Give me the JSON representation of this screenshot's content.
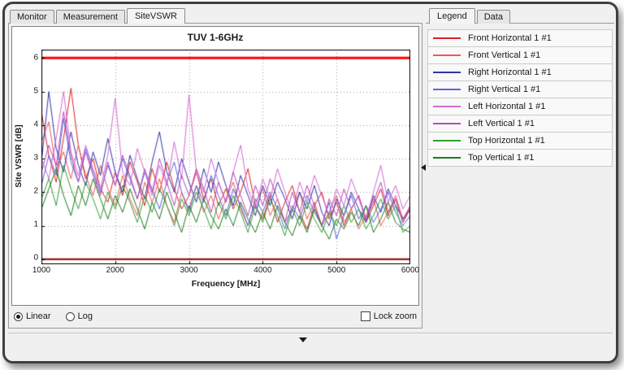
{
  "tabs": {
    "main": [
      {
        "label": "Monitor",
        "active": false
      },
      {
        "label": "Measurement",
        "active": false
      },
      {
        "label": "SiteVSWR",
        "active": true
      }
    ],
    "right": [
      {
        "label": "Legend",
        "active": true
      },
      {
        "label": "Data",
        "active": false
      }
    ]
  },
  "controls": {
    "linear_label": "Linear",
    "log_label": "Log",
    "scale_selected": "Linear",
    "lock_zoom_label": "Lock zoom",
    "lock_zoom_checked": false
  },
  "legend_panel": {
    "items": [
      {
        "label": "Front Horizontal 1 #1",
        "color": "#dd2222"
      },
      {
        "label": "Front Vertical 1 #1",
        "color": "#e85c5c"
      },
      {
        "label": "Right Horizontal 1 #1",
        "color": "#3333aa"
      },
      {
        "label": "Right Vertical 1 #1",
        "color": "#5566e0"
      },
      {
        "label": "Left Horizontal 1 #1",
        "color": "#d46ad4"
      },
      {
        "label": "Left Vertical 1 #1",
        "color": "#b84ab8"
      },
      {
        "label": "Top Horizontal 1 #1",
        "color": "#33a033"
      },
      {
        "label": "Top Vertical 1 #1",
        "color": "#1e7a1e"
      }
    ]
  },
  "chart_data": {
    "type": "line",
    "title": "TUV 1-6GHz",
    "xlabel": "Frequency [MHz]",
    "ylabel": "Site VSWR [dB]",
    "x_range": [
      1000,
      6000
    ],
    "y_range": [
      -0.15,
      6.25
    ],
    "x_ticks": [
      1000,
      2000,
      3000,
      4000,
      5000,
      6000
    ],
    "y_ticks": [
      0,
      1,
      2,
      3,
      4,
      5,
      6
    ],
    "x_start": 1000,
    "x_step": 100,
    "grid": "dotted",
    "legend_position": "right-panel",
    "limit_lines": [
      {
        "name": "upper-limit",
        "value": 6.0,
        "color": "#ff0000",
        "width": 3
      },
      {
        "name": "baseline",
        "value": 0.0,
        "color": "#8b0000",
        "width": 2
      }
    ],
    "series": [
      {
        "name": "Front Horizontal 1 #1",
        "color": "#dd2222",
        "values": [
          4.4,
          3.1,
          2.3,
          3.6,
          5.1,
          3.4,
          2.4,
          3.0,
          2.1,
          1.7,
          2.6,
          1.9,
          2.9,
          2.3,
          1.6,
          2.7,
          2.0,
          2.9,
          2.1,
          1.5,
          1.9,
          2.6,
          1.8,
          2.4,
          1.6,
          2.1,
          1.5,
          2.0,
          2.7,
          1.6,
          1.2,
          1.9,
          1.1,
          1.7,
          2.2,
          1.4,
          0.9,
          1.6,
          2.0,
          1.2,
          1.7,
          1.0,
          1.5,
          1.9,
          1.1,
          1.6,
          2.1,
          1.3,
          1.8,
          1.1,
          1.5
        ]
      },
      {
        "name": "Front Vertical 1 #1",
        "color": "#e85c5c",
        "values": [
          3.5,
          4.1,
          2.7,
          3.2,
          2.4,
          3.4,
          2.5,
          1.9,
          2.8,
          2.1,
          1.6,
          2.5,
          1.8,
          1.3,
          2.3,
          1.7,
          2.4,
          1.6,
          1.1,
          2.0,
          1.5,
          2.2,
          1.4,
          1.9,
          1.2,
          1.8,
          2.3,
          1.5,
          1.0,
          1.7,
          2.1,
          1.3,
          1.8,
          1.1,
          1.5,
          2.0,
          1.2,
          1.7,
          1.0,
          1.4,
          1.9,
          1.1,
          1.5,
          0.9,
          1.3,
          1.8,
          1.0,
          1.4,
          1.9,
          1.2,
          1.6
        ]
      },
      {
        "name": "Right Horizontal 1 #1",
        "color": "#3333aa",
        "values": [
          2.9,
          5.0,
          3.3,
          2.6,
          3.8,
          2.8,
          2.2,
          3.2,
          2.5,
          3.6,
          2.6,
          2.0,
          3.1,
          2.4,
          1.8,
          2.9,
          3.8,
          2.6,
          2.0,
          3.0,
          2.3,
          1.7,
          2.7,
          2.0,
          2.9,
          2.2,
          1.6,
          2.5,
          1.9,
          1.3,
          2.2,
          1.6,
          2.3,
          1.8,
          1.2,
          2.0,
          1.5,
          2.2,
          1.4,
          1.0,
          1.8,
          1.3,
          2.0,
          1.5,
          1.1,
          1.9,
          1.4,
          2.1,
          1.6,
          1.2,
          1.5
        ]
      },
      {
        "name": "Right Vertical 1 #1",
        "color": "#5566e0",
        "values": [
          2.2,
          3.1,
          2.5,
          4.2,
          2.9,
          2.3,
          3.3,
          2.6,
          2.0,
          2.8,
          2.2,
          3.0,
          2.4,
          1.8,
          2.6,
          2.1,
          1.5,
          2.3,
          2.9,
          2.0,
          1.4,
          2.2,
          1.7,
          2.5,
          1.9,
          1.3,
          2.1,
          1.6,
          1.0,
          1.8,
          1.4,
          2.0,
          1.5,
          0.9,
          1.6,
          1.2,
          1.9,
          1.4,
          1.0,
          1.7,
          0.6,
          1.3,
          1.9,
          1.2,
          1.6,
          1.1,
          1.5,
          2.0,
          1.4,
          1.0,
          1.3
        ]
      },
      {
        "name": "Left Horizontal 1 #1",
        "color": "#d46ad4",
        "values": [
          3.0,
          2.4,
          3.6,
          5.0,
          3.2,
          2.5,
          3.4,
          2.7,
          2.1,
          3.1,
          4.8,
          2.6,
          2.2,
          3.3,
          2.6,
          1.9,
          2.8,
          2.2,
          3.5,
          2.4,
          4.9,
          2.6,
          2.0,
          3.0,
          2.3,
          1.7,
          2.6,
          3.4,
          2.1,
          1.5,
          2.4,
          1.8,
          2.7,
          2.0,
          1.4,
          2.3,
          1.7,
          2.5,
          1.9,
          1.3,
          2.1,
          1.6,
          2.4,
          1.8,
          1.2,
          2.0,
          2.8,
          1.7,
          2.2,
          1.5,
          1.9
        ]
      },
      {
        "name": "Left Vertical 1 #1",
        "color": "#b84ab8",
        "values": [
          2.6,
          3.4,
          2.8,
          4.4,
          3.1,
          2.3,
          3.2,
          2.5,
          1.9,
          2.9,
          2.2,
          3.1,
          2.5,
          1.8,
          2.7,
          2.0,
          3.0,
          2.3,
          1.6,
          2.5,
          1.9,
          2.7,
          2.1,
          1.4,
          2.3,
          1.7,
          2.6,
          1.9,
          1.3,
          2.2,
          1.6,
          2.4,
          1.8,
          1.1,
          2.0,
          1.4,
          2.2,
          1.6,
          1.0,
          1.8,
          1.3,
          2.1,
          1.5,
          1.9,
          1.2,
          1.7,
          2.3,
          1.4,
          1.8,
          1.1,
          1.6
        ]
      },
      {
        "name": "Top Horizontal 1 #1",
        "color": "#33a033",
        "values": [
          1.8,
          2.4,
          1.6,
          2.8,
          2.1,
          1.5,
          2.3,
          1.8,
          1.2,
          2.0,
          1.5,
          2.2,
          1.7,
          1.1,
          1.9,
          1.4,
          2.1,
          1.6,
          1.0,
          1.8,
          1.3,
          2.0,
          1.5,
          0.9,
          1.7,
          1.2,
          1.9,
          1.4,
          0.8,
          1.6,
          1.1,
          1.8,
          1.3,
          0.7,
          1.5,
          1.0,
          1.7,
          1.2,
          0.8,
          1.4,
          1.0,
          1.6,
          1.1,
          1.5,
          0.9,
          1.3,
          1.8,
          1.2,
          1.6,
          0.8,
          1.0
        ]
      },
      {
        "name": "Top Vertical 1 #1",
        "color": "#1e7a1e",
        "values": [
          1.5,
          2.1,
          2.7,
          1.9,
          1.3,
          2.2,
          1.6,
          2.4,
          1.8,
          1.2,
          1.9,
          1.4,
          2.1,
          1.5,
          0.9,
          1.7,
          1.2,
          2.0,
          1.4,
          0.8,
          1.6,
          1.1,
          1.8,
          1.3,
          0.9,
          1.5,
          1.0,
          1.7,
          1.2,
          0.8,
          1.4,
          0.9,
          1.6,
          1.1,
          0.7,
          1.3,
          0.8,
          1.5,
          1.0,
          0.6,
          1.2,
          0.9,
          1.4,
          1.0,
          1.6,
          0.8,
          1.2,
          1.7,
          1.1,
          0.9,
          0.8
        ]
      }
    ]
  }
}
